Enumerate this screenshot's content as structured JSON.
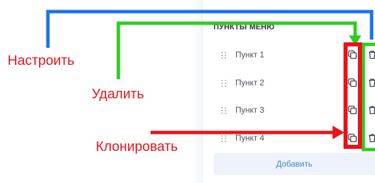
{
  "panel": {
    "title": "ПУНКТЫ МЕНЮ",
    "items": [
      {
        "label": "Пункт 1"
      },
      {
        "label": "Пункт 2"
      },
      {
        "label": "Пункт 3"
      },
      {
        "label": "Пункт 4"
      }
    ],
    "add_label": "Добавить"
  },
  "annotations": {
    "configure": "Настроить",
    "delete": "Удалить",
    "clone": "Клонировать"
  },
  "colors": {
    "configure_arrow": "#1a73e8",
    "delete_arrow": "#2ecc22",
    "clone_arrow": "#e8141b",
    "accent": "#4a7fd1",
    "add_bg": "#eef3fb"
  },
  "icons": {
    "drag": "drag-handle-icon",
    "clone": "copy-icon",
    "delete": "trash-icon"
  }
}
